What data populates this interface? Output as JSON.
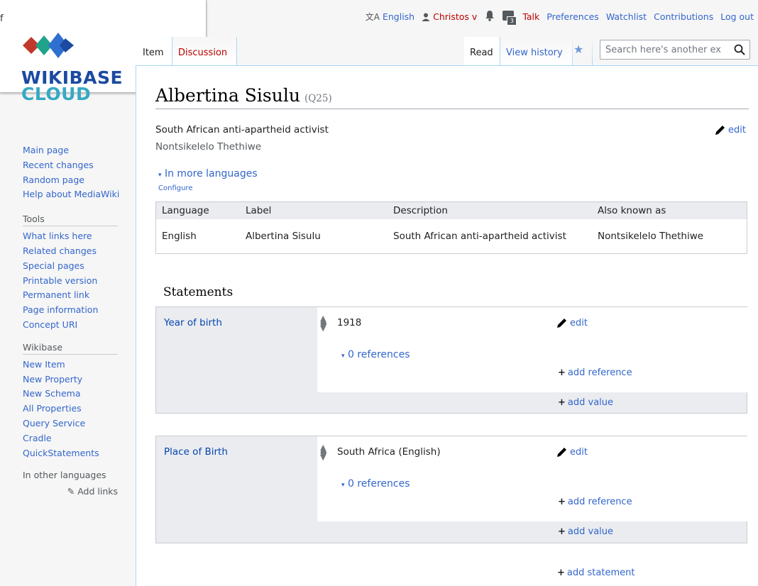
{
  "background_window": {
    "text": "f"
  },
  "personal": {
    "language": "English",
    "user": "Christos v",
    "notices_count": "3",
    "talk": "Talk",
    "preferences": "Preferences",
    "watchlist": "Watchlist",
    "contributions": "Contributions",
    "logout": "Log out"
  },
  "logo": {
    "line1": "WIKIBASE",
    "line2": "CLOUD"
  },
  "tabs": {
    "item": "Item",
    "discussion": "Discussion",
    "read": "Read",
    "view_history": "View history"
  },
  "search": {
    "placeholder": "Search here's another ex"
  },
  "sidebar": {
    "nav": [
      "Main page",
      "Recent changes",
      "Random page",
      "Help about MediaWiki"
    ],
    "tools_heading": "Tools",
    "tools": [
      "What links here",
      "Related changes",
      "Special pages",
      "Printable version",
      "Permanent link",
      "Page information",
      "Concept URI"
    ],
    "wikibase_heading": "Wikibase",
    "wikibase": [
      "New Item",
      "New Property",
      "New Schema",
      "All Properties",
      "Query Service",
      "Cradle",
      "QuickStatements"
    ],
    "languages_heading": "In other languages",
    "add_links": "Add links"
  },
  "page": {
    "title": "Albertina Sisulu",
    "qid": "(Q25)",
    "description": "South African anti-apartheid activist",
    "alias": "Nontsikelelo Thethiwe",
    "edit": "edit",
    "more_languages": "In more languages",
    "configure": "Configure"
  },
  "lang_table": {
    "headers": [
      "Language",
      "Label",
      "Description",
      "Also known as"
    ],
    "row": [
      "English",
      "Albertina Sisulu",
      "South African anti-apartheid activist",
      "Nontsikelelo Thethiwe"
    ]
  },
  "statements": {
    "heading": "Statements",
    "groups": [
      {
        "property": "Year of birth",
        "value": "1918",
        "edit": "edit",
        "references": "0 references",
        "add_reference": "add reference",
        "add_value": "add value"
      },
      {
        "property": "Place of Birth",
        "value": "South Africa (English)",
        "edit": "edit",
        "references": "0 references",
        "add_reference": "add reference",
        "add_value": "add value"
      }
    ],
    "add_statement": "add statement"
  },
  "colors": {
    "link": "#3366cc",
    "red_link": "#ba0000",
    "border": "#a7d7f9",
    "logo_blue": "#1b4aa0",
    "logo_cyan": "#36a9c4",
    "logo_red": "#c0392b"
  }
}
